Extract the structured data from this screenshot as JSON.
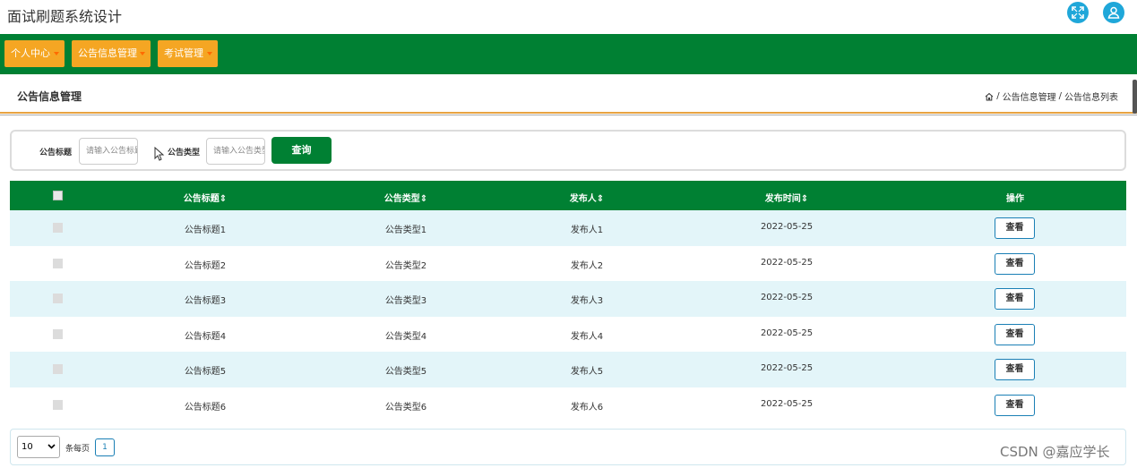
{
  "app": {
    "title": "面试刷题系统设计"
  },
  "nav": {
    "items": [
      {
        "label": "个人中心"
      },
      {
        "label": "公告信息管理"
      },
      {
        "label": "考试管理"
      }
    ]
  },
  "page": {
    "title": "公告信息管理",
    "breadcrumb": [
      "公告信息管理",
      "公告信息列表"
    ],
    "breadcrumb_sep": "/"
  },
  "search": {
    "title_label": "公告标题",
    "title_placeholder": "请输入公告标题",
    "type_label": "公告类型",
    "type_placeholder": "请输入公告类型",
    "button_label": "查询"
  },
  "table": {
    "columns": [
      "公告标题",
      "公告类型",
      "发布人",
      "发布时间",
      "操作"
    ],
    "sort_icon": "⇕",
    "rows": [
      {
        "title": "公告标题1",
        "type": "公告类型1",
        "publisher": "发布人1",
        "time": "2022-05-25",
        "action": "查看"
      },
      {
        "title": "公告标题2",
        "type": "公告类型2",
        "publisher": "发布人2",
        "time": "2022-05-25",
        "action": "查看"
      },
      {
        "title": "公告标题3",
        "type": "公告类型3",
        "publisher": "发布人3",
        "time": "2022-05-25",
        "action": "查看"
      },
      {
        "title": "公告标题4",
        "type": "公告类型4",
        "publisher": "发布人4",
        "time": "2022-05-25",
        "action": "查看"
      },
      {
        "title": "公告标题5",
        "type": "公告类型5",
        "publisher": "发布人5",
        "time": "2022-05-25",
        "action": "查看"
      },
      {
        "title": "公告标题6",
        "type": "公告类型6",
        "publisher": "发布人6",
        "time": "2022-05-25",
        "action": "查看"
      }
    ]
  },
  "pager": {
    "page_size": "10",
    "per_page_text": "条每页",
    "current_page": "1"
  },
  "watermark": "CSDN @嘉应学长",
  "colors": {
    "primary_green": "#008033",
    "nav_orange": "#f5a623",
    "row_alt": "#e3f5f9",
    "accent_blue": "#1fa7d9"
  },
  "icons": {
    "fullscreen": "fullscreen-icon",
    "user": "user-icon",
    "home": "home-icon"
  }
}
